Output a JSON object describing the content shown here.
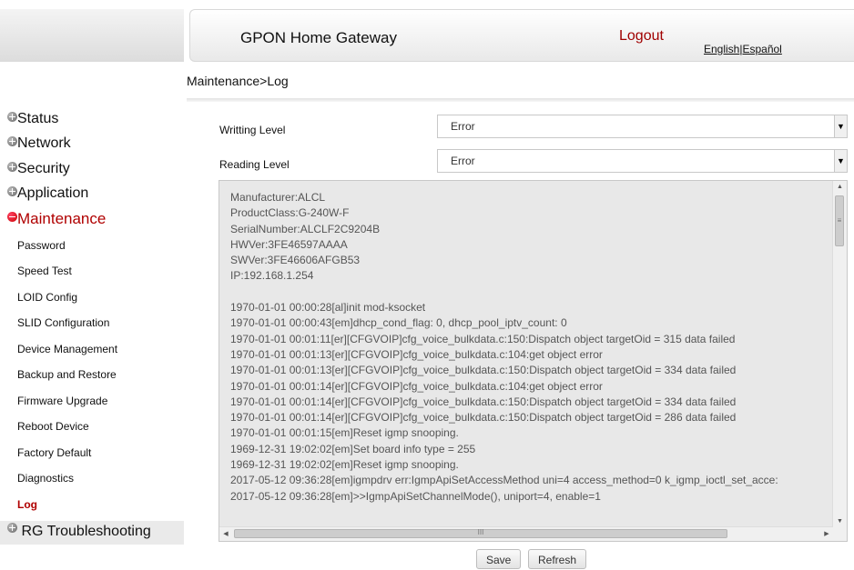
{
  "header": {
    "title": "GPON Home Gateway",
    "logout": "Logout",
    "lang_english": "English",
    "lang_sep": "|",
    "lang_espanol": "Español"
  },
  "breadcrumb": "Maintenance>Log",
  "sidebar": {
    "groups": [
      {
        "label": "Status",
        "expanded": false
      },
      {
        "label": "Network",
        "expanded": false
      },
      {
        "label": "Security",
        "expanded": false
      },
      {
        "label": "Application",
        "expanded": false
      },
      {
        "label": "Maintenance",
        "expanded": true
      }
    ],
    "maintenance_items": [
      "Password",
      "Speed Test",
      "LOID Config",
      "SLID Configuration",
      "Device Management",
      "Backup and Restore",
      "Firmware Upgrade",
      "Reboot Device",
      "Factory Default",
      "Diagnostics",
      "Log"
    ],
    "active_item": "Log",
    "rg_troubleshooting": "RG Troubleshooting"
  },
  "writing_level": {
    "label": "Writting Level",
    "value": "Error"
  },
  "reading_level": {
    "label": "Reading Level",
    "value": "Error"
  },
  "log_lines": [
    "Manufacturer:ALCL",
    "ProductClass:G-240W-F",
    "SerialNumber:ALCLF2C9204B",
    "HWVer:3FE46597AAAA",
    "SWVer:3FE46606AFGB53",
    "IP:192.168.1.254",
    "",
    "1970-01-01 00:00:28[al]init mod-ksocket",
    "1970-01-01 00:00:43[em]dhcp_cond_flag: 0, dhcp_pool_iptv_count: 0",
    "1970-01-01 00:01:11[er][CFGVOIP]cfg_voice_bulkdata.c:150:Dispatch object targetOid = 315 data failed",
    "1970-01-01 00:01:13[er][CFGVOIP]cfg_voice_bulkdata.c:104:get object error",
    "1970-01-01 00:01:13[er][CFGVOIP]cfg_voice_bulkdata.c:150:Dispatch object targetOid = 334 data failed",
    "1970-01-01 00:01:14[er][CFGVOIP]cfg_voice_bulkdata.c:104:get object error",
    "1970-01-01 00:01:14[er][CFGVOIP]cfg_voice_bulkdata.c:150:Dispatch object targetOid = 334 data failed",
    "1970-01-01 00:01:14[er][CFGVOIP]cfg_voice_bulkdata.c:150:Dispatch object targetOid = 286 data failed",
    "1970-01-01 00:01:15[em]Reset igmp snooping.",
    "1969-12-31 19:02:02[em]Set board info type = 255",
    "1969-12-31 19:02:02[em]Reset igmp snooping.",
    "2017-05-12 09:36:28[em]igmpdrv err:IgmpApiSetAccessMethod uni=4 access_method=0 k_igmp_ioctl_set_acce:",
    "2017-05-12 09:36:28[em]>>IgmpApiSetChannelMode(), uniport=4, enable=1"
  ],
  "buttons": {
    "save": "Save",
    "refresh": "Refresh"
  },
  "scroll_glyphs": {
    "up": "▲",
    "down": "▼",
    "left": "◀",
    "right": "▶",
    "vgrip": "≡",
    "hgrip": "III"
  },
  "colors": {
    "accent_red": "#b00000",
    "log_bg": "#e8e8e8"
  }
}
